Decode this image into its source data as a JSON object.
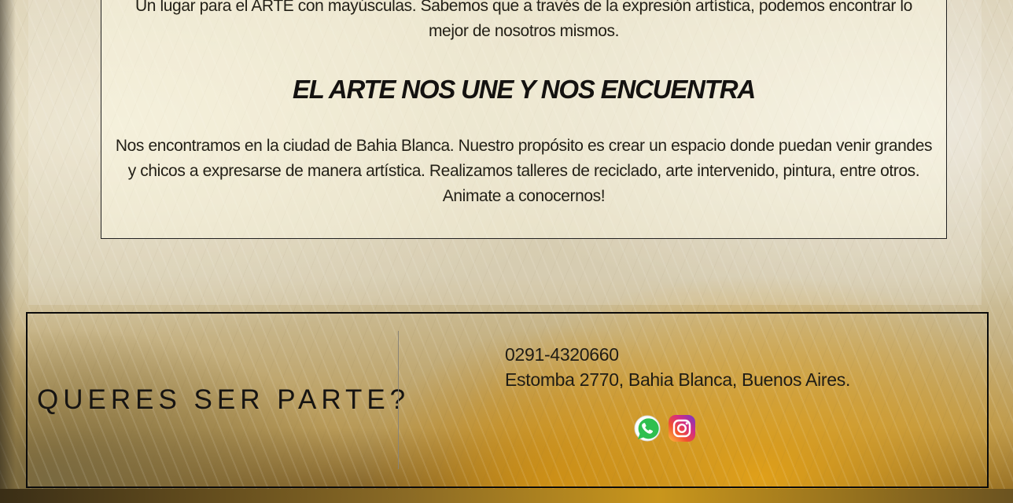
{
  "about": {
    "intro": "Un lugar para el ARTE con mayúsculas. Sabemos que a través de la expresión artística, podemos encontrar lo mejor de nosotros mismos.",
    "tagline": "EL ARTE NOS UNE Y NOS ENCUENTRA",
    "description": "Nos encontramos en la ciudad de Bahia Blanca. Nuestro propósito es crear un espacio donde puedan venir grandes y chicos a expresarse de manera artística. Realizamos talleres de reciclado, arte intervenido, pintura, entre otros. Animate a conocernos!"
  },
  "footer": {
    "cta": "QUERES SER PARTE?",
    "phone": "0291-4320660",
    "address": "Estomba 2770, Bahia Blanca, Buenos Aires.",
    "social": [
      {
        "icon": "whatsapp-icon",
        "color": "#25d366"
      },
      {
        "icon": "instagram-icon",
        "color": "#c13584"
      }
    ]
  }
}
